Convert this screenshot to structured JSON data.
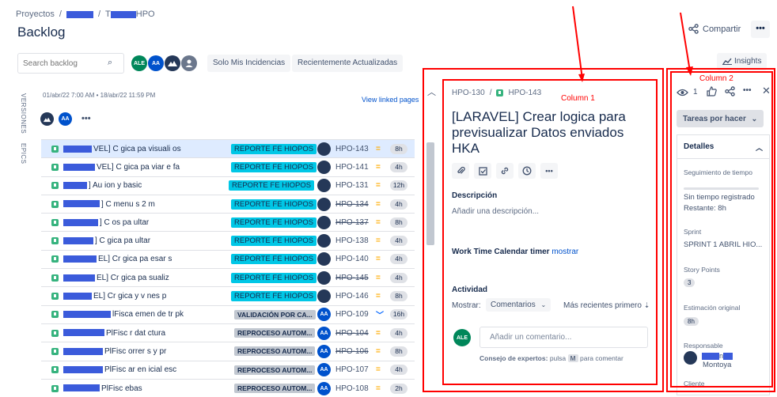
{
  "breadcrumb": {
    "root": "Proyectos",
    "sep": "/",
    "project_suffix": "",
    "board_suffix": "HPO"
  },
  "page_title": "Backlog",
  "header": {
    "share_label": "Compartir",
    "more_label": "•••"
  },
  "toolbar": {
    "search_placeholder": "Search backlog",
    "avatars": [
      {
        "initials": "ALE",
        "color": "#00875a"
      },
      {
        "initials": "AA",
        "color": "#0052cc"
      },
      {
        "initials": "",
        "color": "#253858"
      },
      {
        "initials": "",
        "color": "#6b778c"
      }
    ],
    "filters": [
      "Solo Mis Incidencias",
      "Recientemente Actualizadas"
    ],
    "insights_label": "Insights"
  },
  "side_tabs": {
    "versions": "VERSIONES",
    "epics": "EPICS"
  },
  "sprint": {
    "dates": "01/abr/22 7:00 AM • 18/abr/22 11:59 PM",
    "view_linked": "View linked pages",
    "member_initials": "AA"
  },
  "issues": [
    {
      "summary": "VEL] C gica pa visuali os",
      "epic": "REPORTE FE HIOPOS",
      "epic_style": "cyan",
      "assignee": "dark",
      "assignee_initials": "",
      "key": "HPO-143",
      "strike": false,
      "prio": "=",
      "prio_style": "med",
      "est": "8h",
      "selected": true
    },
    {
      "summary": "VEL] C gica pa viar e fa",
      "epic": "REPORTE FE HIOPOS",
      "epic_style": "cyan",
      "assignee": "dark",
      "assignee_initials": "",
      "key": "HPO-141",
      "strike": false,
      "prio": "=",
      "prio_style": "med",
      "est": "4h",
      "selected": false
    },
    {
      "summary": "] Au ion y basic",
      "epic": "REPORTE FE HIOPOS",
      "epic_style": "cyan",
      "assignee": "dark",
      "assignee_initials": "",
      "key": "HPO-131",
      "strike": false,
      "prio": "=",
      "prio_style": "med",
      "est": "12h",
      "selected": false
    },
    {
      "summary": "] C menu s 2 m",
      "epic": "REPORTE FE HIOPOS",
      "epic_style": "cyan",
      "assignee": "dark",
      "assignee_initials": "",
      "key": "HPO-134",
      "strike": true,
      "prio": "=",
      "prio_style": "med",
      "est": "4h",
      "selected": false
    },
    {
      "summary": "] C os pa ultar",
      "epic": "REPORTE FE HIOPOS",
      "epic_style": "cyan",
      "assignee": "dark",
      "assignee_initials": "",
      "key": "HPO-137",
      "strike": true,
      "prio": "=",
      "prio_style": "med",
      "est": "8h",
      "selected": false
    },
    {
      "summary": "] C gica pa ultar",
      "epic": "REPORTE FE HIOPOS",
      "epic_style": "cyan",
      "assignee": "dark",
      "assignee_initials": "",
      "key": "HPO-138",
      "strike": false,
      "prio": "=",
      "prio_style": "med",
      "est": "4h",
      "selected": false
    },
    {
      "summary": "EL] Cr gica pa esar s",
      "epic": "REPORTE FE HIOPOS",
      "epic_style": "cyan",
      "assignee": "dark",
      "assignee_initials": "",
      "key": "HPO-140",
      "strike": false,
      "prio": "=",
      "prio_style": "med",
      "est": "4h",
      "selected": false
    },
    {
      "summary": "EL] Cr gica pa sualiz",
      "epic": "REPORTE FE HIOPOS",
      "epic_style": "cyan",
      "assignee": "dark",
      "assignee_initials": "",
      "key": "HPO-145",
      "strike": true,
      "prio": "=",
      "prio_style": "med",
      "est": "4h",
      "selected": false
    },
    {
      "summary": "EL] Cr gica y v nes p",
      "epic": "REPORTE FE HIOPOS",
      "epic_style": "cyan",
      "assignee": "dark",
      "assignee_initials": "",
      "key": "HPO-146",
      "strike": false,
      "prio": "=",
      "prio_style": "med",
      "est": "8h",
      "selected": false
    },
    {
      "summary": "lFisca emen de tr pk",
      "epic": "VALIDACIÓN POR CA...",
      "epic_style": "grey",
      "assignee": "blue",
      "assignee_initials": "AA",
      "key": "HPO-109",
      "strike": false,
      "prio": "﹀",
      "prio_style": "low",
      "est": "16h",
      "selected": false
    },
    {
      "summary": "PlFisc r dat ctura",
      "epic": "REPROCESO AUTOM...",
      "epic_style": "grey",
      "assignee": "blue",
      "assignee_initials": "AA",
      "key": "HPO-104",
      "strike": true,
      "prio": "=",
      "prio_style": "med",
      "est": "4h",
      "selected": false
    },
    {
      "summary": "PlFisc orrer s y pr",
      "epic": "REPROCESO AUTOM...",
      "epic_style": "grey",
      "assignee": "blue",
      "assignee_initials": "AA",
      "key": "HPO-106",
      "strike": true,
      "prio": "=",
      "prio_style": "med",
      "est": "8h",
      "selected": false
    },
    {
      "summary": "PlFisc ar en icial esc",
      "epic": "REPROCESO AUTOM...",
      "epic_style": "grey",
      "assignee": "blue",
      "assignee_initials": "AA",
      "key": "HPO-107",
      "strike": false,
      "prio": "=",
      "prio_style": "med",
      "est": "4h",
      "selected": false
    },
    {
      "summary": "PlFisc ebas",
      "epic": "REPROCESO AUTOM...",
      "epic_style": "grey",
      "assignee": "blue",
      "assignee_initials": "AA",
      "key": "HPO-108",
      "strike": false,
      "prio": "=",
      "prio_style": "med",
      "est": "2h",
      "selected": false
    }
  ],
  "annotations": {
    "column1": "Column 1",
    "column2": "Column 2"
  },
  "issue_detail": {
    "parent_key": "HPO-130",
    "key": "HPO-143",
    "title": "[LARAVEL] Crear logica para previsualizar Datos enviados HKA",
    "tools": [
      "📎",
      "☑",
      "🔗",
      "◷",
      "•••"
    ],
    "description_label": "Descripción",
    "description_placeholder": "Añadir una descripción...",
    "timer_label": "Work Time Calendar timer",
    "timer_link": "mostrar",
    "activity_label": "Actividad",
    "show_label": "Mostrar:",
    "show_value": "Comentarios",
    "sort_label": "Más recientes primero",
    "commenter_initials": "ALE",
    "comment_placeholder": "Añadir un comentario...",
    "tip_prefix": "Consejo de expertos:",
    "tip_mid": "pulsa",
    "tip_key": "M",
    "tip_suffix": "para comentar"
  },
  "side_panel": {
    "watch_count": "1",
    "status": "Tareas por hacer",
    "details_label": "Detalles",
    "tracking_label": "Seguimiento de tiempo",
    "tracking_value": "Sin tiempo registrado",
    "tracking_remaining": "Restante: 8h",
    "sprint_label": "Sprint",
    "sprint_value": "SPRINT 1 ABRIL HIO...",
    "points_label": "Story Points",
    "points_value": "3",
    "estimate_label": "Estimación original",
    "estimate_value": "8h",
    "assignee_label": "Responsable",
    "assignee_value": "Montoya",
    "client_label": "Cliente"
  }
}
